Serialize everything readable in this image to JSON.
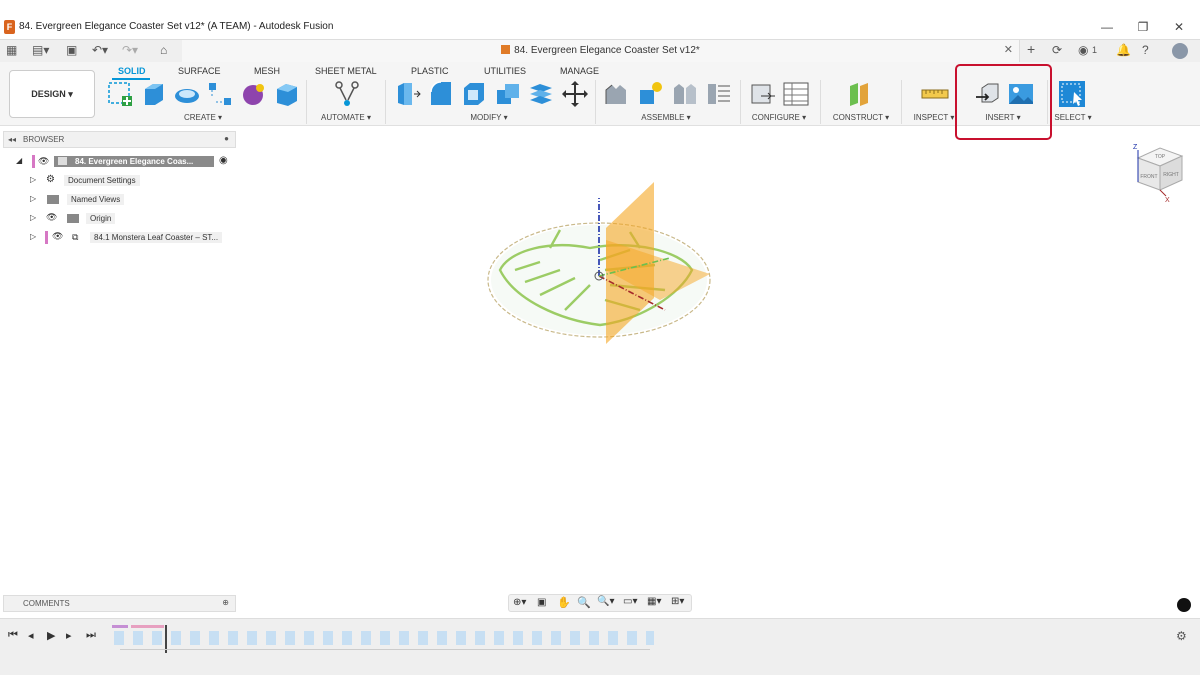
{
  "window": {
    "title": "84. Evergreen Elegance Coaster Set v12* (A TEAM) - Autodesk Fusion",
    "app_icon": "F",
    "controls": [
      "—",
      "❐",
      "✕"
    ]
  },
  "tab": {
    "title": "84. Evergreen Elegance Coaster Set v12*",
    "job_count": "1"
  },
  "toolbar": {
    "workspace": "DESIGN",
    "tabs": [
      "SOLID",
      "SURFACE",
      "MESH",
      "SHEET METAL",
      "PLASTIC",
      "UTILITIES",
      "MANAGE"
    ],
    "active_tab": "SOLID",
    "groups": {
      "create": "CREATE",
      "automate": "AUTOMATE",
      "modify": "MODIFY",
      "assemble": "ASSEMBLE",
      "configure": "CONFIGURE",
      "construct": "CONSTRUCT",
      "inspect": "INSPECT",
      "insert": "INSERT",
      "select": "SELECT"
    }
  },
  "browser": {
    "header": "BROWSER",
    "items": [
      {
        "label": "84. Evergreen Elegance Coas..."
      },
      {
        "label": "Document Settings"
      },
      {
        "label": "Named Views"
      },
      {
        "label": "Origin"
      },
      {
        "label": "84.1 Monstera Leaf Coaster – ST..."
      }
    ]
  },
  "comments": {
    "header": "COMMENTS"
  },
  "viewcube": {
    "top": "TOP",
    "front": "FRONT",
    "right": "RIGHT",
    "axis_z": "Z",
    "axis_x": "X"
  },
  "colors": {
    "accent": "#0696d7",
    "highlight": "#c8102e",
    "plane": "#f5a623",
    "leaf": "#9ccc65"
  }
}
